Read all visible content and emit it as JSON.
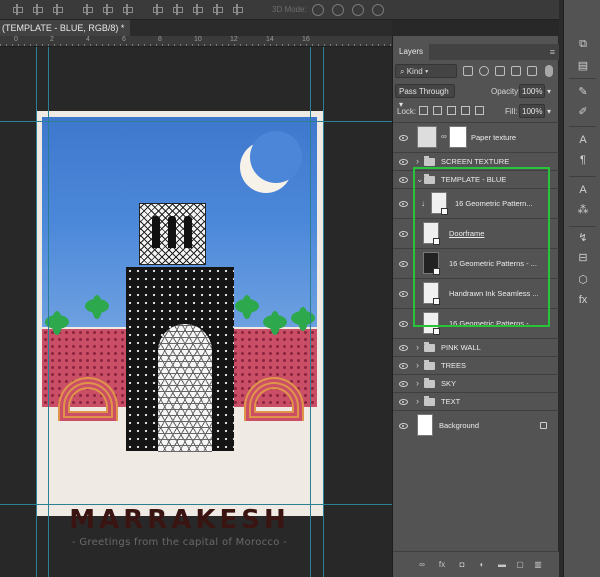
{
  "toolbar": {
    "mode_label": "3D Mode:"
  },
  "document": {
    "tab_title": "(TEMPLATE - BLUE, RGB/8) *"
  },
  "ruler": {
    "marks": [
      "0",
      "2",
      "4",
      "6",
      "8",
      "10",
      "12",
      "14",
      "16"
    ]
  },
  "poster": {
    "title": "MARRAKESH",
    "subtitle": "- Greetings from the capital of Morocco -"
  },
  "layers_panel": {
    "tab_label": "Layers",
    "filter_kind": "Kind",
    "blend_mode": "Pass Through",
    "opacity_label": "Opacity:",
    "opacity_value": "100%",
    "lock_label": "Lock:",
    "fill_label": "Fill:",
    "fill_value": "100%",
    "layers": [
      {
        "name": "Paper texture",
        "kind": "pixel"
      },
      {
        "name": "SCREEN TEXTURE",
        "kind": "group"
      },
      {
        "name": "TEMPLATE - BLUE",
        "kind": "group",
        "expanded": true
      },
      {
        "name": "16 Geometric Pattern...",
        "kind": "smart"
      },
      {
        "name": "Doorframe",
        "kind": "smart"
      },
      {
        "name": "16 Geometric Patterns - ...",
        "kind": "smart"
      },
      {
        "name": "Handrawn Ink Seamless ...",
        "kind": "smart"
      },
      {
        "name": "16 Geometric Patterns - ...",
        "kind": "smart"
      },
      {
        "name": "PINK WALL",
        "kind": "group"
      },
      {
        "name": "TREES",
        "kind": "group"
      },
      {
        "name": "SKY",
        "kind": "group"
      },
      {
        "name": "TEXT",
        "kind": "group"
      },
      {
        "name": "Background",
        "kind": "background"
      }
    ],
    "bottom_icons": [
      "link-icon",
      "fx-icon",
      "mask-icon",
      "adjustment-icon",
      "new-group-icon",
      "new-layer-icon",
      "trash-icon"
    ]
  },
  "colors": {
    "selection_highlight": "#27c43a",
    "guides": "#2a7f93"
  }
}
